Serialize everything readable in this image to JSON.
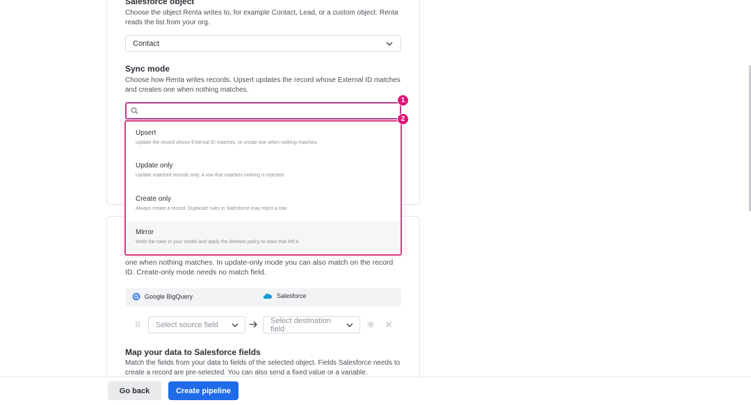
{
  "object_section": {
    "title": "Salesforce object",
    "description": "Choose the object Renta writes to, for example Contact, Lead, or a custom object. Renta reads the list from your org.",
    "selected": "Contact"
  },
  "sync_section": {
    "title": "Sync mode",
    "description": "Choose how Renta writes records. Upsert updates the record whose External ID matches and creates one when nothing matches.",
    "search_value": "",
    "options": [
      {
        "label": "Upsert",
        "description": "Update the record whose External ID matches, or create one when nothing matches."
      },
      {
        "label": "Update only",
        "description": "Update matched records only. A row that matches nothing is rejected."
      },
      {
        "label": "Create only",
        "description": "Always create a record. Duplicate rules in Salesforce may reject a row."
      },
      {
        "label": "Mirror",
        "description": "Write the rows in your model and apply the deletion policy to rows that left it."
      }
    ]
  },
  "badges": {
    "one": "1",
    "two": "2"
  },
  "match_section": {
    "description": "one when nothing matches. In update-only mode you can also match on the record ID. Create-only mode needs no match field.",
    "source_name": "Google BigQuery",
    "destination_name": "Salesforce",
    "source_placeholder": "Select source field",
    "destination_placeholder": "Select destination field"
  },
  "map_section": {
    "title": "Map your data to Salesforce fields",
    "description": "Match the fields from your data to fields of the selected object. Fields Salesforce needs to create a record are pre-selected. You can also send a fixed value or a variable."
  },
  "footer": {
    "back_label": "Go back",
    "create_label": "Create pipeline"
  },
  "colors": {
    "accent": "#1f6be8",
    "badge": "#e0157a",
    "highlight_border": "#e0367d"
  }
}
